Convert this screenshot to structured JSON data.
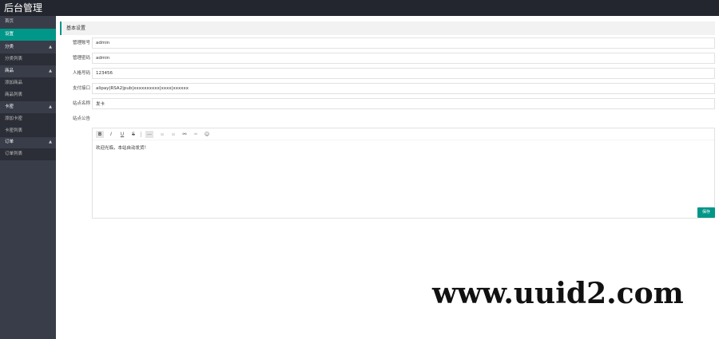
{
  "app": {
    "title": "后台管理"
  },
  "sidebar": {
    "items": [
      {
        "type": "item",
        "label": "首页",
        "active": false
      },
      {
        "type": "item",
        "label": "设置",
        "active": true
      },
      {
        "type": "group",
        "label": "分类",
        "caret": "▲"
      },
      {
        "type": "sub",
        "label": "分类列表"
      },
      {
        "type": "group",
        "label": "商品",
        "caret": "▲"
      },
      {
        "type": "sub",
        "label": "添加商品"
      },
      {
        "type": "sub",
        "label": "商品列表"
      },
      {
        "type": "group",
        "label": "卡密",
        "caret": "▲"
      },
      {
        "type": "sub",
        "label": "添加卡密"
      },
      {
        "type": "sub",
        "label": "卡密列表"
      },
      {
        "type": "group",
        "label": "订单",
        "caret": "▲"
      },
      {
        "type": "sub",
        "label": "订单列表"
      }
    ]
  },
  "form": {
    "section_title": "基本设置",
    "fields": [
      {
        "label": "管理账号",
        "value": "admin"
      },
      {
        "label": "管理密码",
        "value": "admin"
      },
      {
        "label": "人格号码",
        "value": "123456"
      },
      {
        "label": "支付接口",
        "value": "alipay|RSA2|pub|xxxxxxxxxx|xxxx|xxxxxx"
      },
      {
        "label": "站点名称",
        "value": "发卡"
      }
    ],
    "editor": {
      "label": "站点公告",
      "content": "欢迎光临，本站自动发货！",
      "toolbar": [
        {
          "name": "bold-tool",
          "glyph": "B"
        },
        {
          "name": "italic-tool",
          "glyph": "I"
        },
        {
          "name": "underline-tool",
          "glyph": "U"
        },
        {
          "name": "strikethrough-tool",
          "glyph": "S"
        },
        {
          "name": "hr-tool",
          "glyph": "—"
        },
        {
          "name": "align-left-tool",
          "glyph": "≡"
        },
        {
          "name": "align-center-tool",
          "glyph": "≡"
        },
        {
          "name": "link-icon",
          "glyph": "⚯"
        },
        {
          "name": "unlink-icon",
          "glyph": "⚮"
        },
        {
          "name": "emoji-icon",
          "glyph": "☺"
        }
      ]
    },
    "submit_label": "保存"
  },
  "watermark": {
    "text": "www.uuid2.com"
  },
  "colors": {
    "accent": "#009688",
    "topbar": "#23262e",
    "sidebar": "#393d49"
  }
}
